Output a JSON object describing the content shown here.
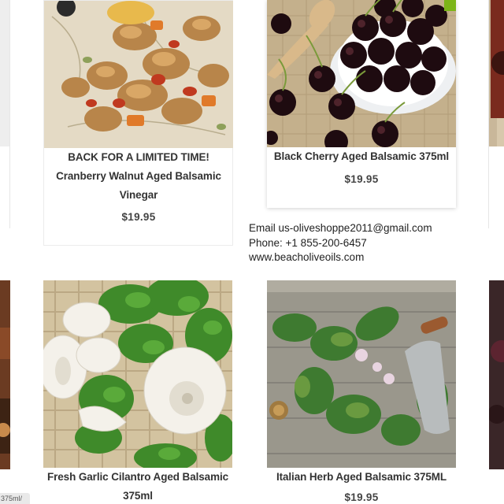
{
  "products": [
    {
      "line1": "BACK FOR A LIMITED TIME!",
      "line2": "Cranberry Walnut Aged Balsamic",
      "line3": "Vinegar",
      "price": "$19.95",
      "image": "walnut-cranberry-photo"
    },
    {
      "line1": "Black Cherry Aged Balsamic 375ml",
      "price": "$19.95",
      "image": "black-cherry-photo"
    },
    {
      "line1": "Fresh Garlic Cilantro Aged Balsamic",
      "line2": "375ml",
      "image": "garlic-cilantro-photo"
    },
    {
      "line1": "Italian Herb Aged Balsamic 375ML",
      "price": "$19.95",
      "image": "italian-herb-photo"
    }
  ],
  "contact": {
    "email": "Email us-oliveshoppe2011@gmail.com",
    "phone": "Phone: +1 855-200-6457",
    "website": "www.beacholiveoils.com"
  },
  "status_bar": {
    "url_fragment": "375ml/"
  },
  "colors": {
    "accent_badge": "#7cb518",
    "text": "#333333",
    "price": "#444444"
  }
}
